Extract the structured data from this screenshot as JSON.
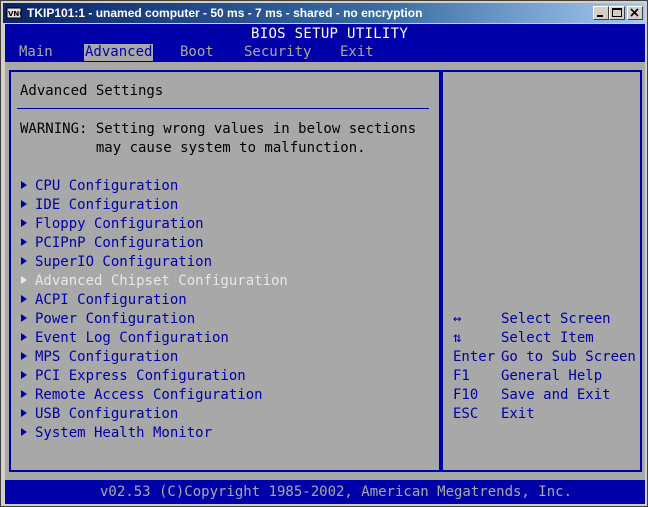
{
  "window": {
    "title": "TKIP101:1 - unamed computer - 50 ms - 7 ms - shared - no encryption"
  },
  "bios": {
    "utility_title": "BIOS SETUP UTILITY",
    "menus": [
      "Main",
      "Advanced",
      "Boot",
      "Security",
      "Exit"
    ],
    "selected_menu": "Advanced",
    "section_title": "Advanced Settings",
    "warning_line1": "WARNING: Setting wrong values in below sections",
    "warning_line2": "         may cause system to malfunction.",
    "items": [
      {
        "label": "CPU Configuration"
      },
      {
        "label": "IDE Configuration"
      },
      {
        "label": "Floppy Configuration"
      },
      {
        "label": "PCIPnP Configuration"
      },
      {
        "label": "SuperIO Configuration"
      },
      {
        "label": "Advanced Chipset Configuration"
      },
      {
        "label": "ACPI Configuration"
      },
      {
        "label": "Power Configuration"
      },
      {
        "label": "Event Log Configuration"
      },
      {
        "label": "MPS Configuration"
      },
      {
        "label": "PCI Express Configuration"
      },
      {
        "label": "Remote Access Configuration"
      },
      {
        "label": "USB Configuration"
      },
      {
        "label": "System Health Monitor"
      }
    ],
    "highlighted_item": "Advanced Chipset Configuration",
    "help": [
      {
        "key": "↔",
        "desc": "Select Screen"
      },
      {
        "key": "⇅",
        "desc": "Select Item"
      },
      {
        "key": "Enter",
        "desc": "Go to Sub Screen"
      },
      {
        "key": "F1",
        "desc": "General Help"
      },
      {
        "key": "F10",
        "desc": "Save and Exit"
      },
      {
        "key": "ESC",
        "desc": "Exit"
      }
    ],
    "footer": "v02.53 (C)Copyright 1985-2002, American Megatrends, Inc."
  },
  "colors": {
    "bios_blue": "#0000a8",
    "bios_gray": "#a8a8a8",
    "titlebar_start": "#0a246a",
    "titlebar_end": "#a6caf0"
  }
}
